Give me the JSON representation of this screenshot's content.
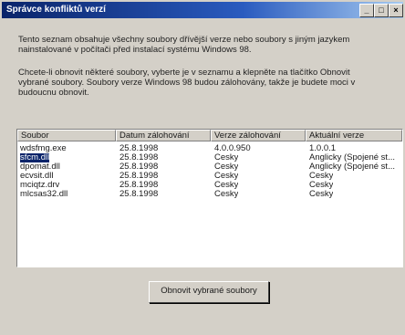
{
  "window": {
    "title": "Správce konfliktů verzí",
    "minimize_label": "_",
    "maximize_label": "□",
    "close_label": "×"
  },
  "intro": {
    "paragraph1": "Tento seznam obsahuje všechny soubory dřívější verze nebo soubory s jiným jazykem nainstalované v počítači před instalací systému Windows 98.",
    "paragraph2": "Chcete-li obnovit některé soubory, vyberte je v seznamu a klepněte na tlačítko Obnovit vybrané soubory. Soubory verze Windows 98 budou zálohovány, takže je budete moci v budoucnu obnovit."
  },
  "list": {
    "columns": [
      "Soubor",
      "Datum zálohování",
      "Verze zálohování",
      "Aktuální verze"
    ],
    "rows": [
      [
        "wdsfmg.exe",
        "25.8.1998",
        "4.0.0.950",
        "1.0.0.1"
      ],
      [
        "sfcm.dll",
        "25.8.1998",
        "Česky",
        "Anglicky (Spojené st..."
      ],
      [
        "dpomat.dll",
        "25.8.1998",
        "Česky",
        "Anglicky (Spojené st..."
      ],
      [
        "ecvsit.dll",
        "25.8.1998",
        "Česky",
        "Česky"
      ],
      [
        "mciqtz.drv",
        "25.8.1998",
        "Česky",
        "Česky"
      ],
      [
        "mlcsas32.dll",
        "25.8.1998",
        "Česky",
        "Česky"
      ]
    ],
    "selected_row": 1
  },
  "restore_button": {
    "label": "Obnovit vybrané soubory"
  }
}
